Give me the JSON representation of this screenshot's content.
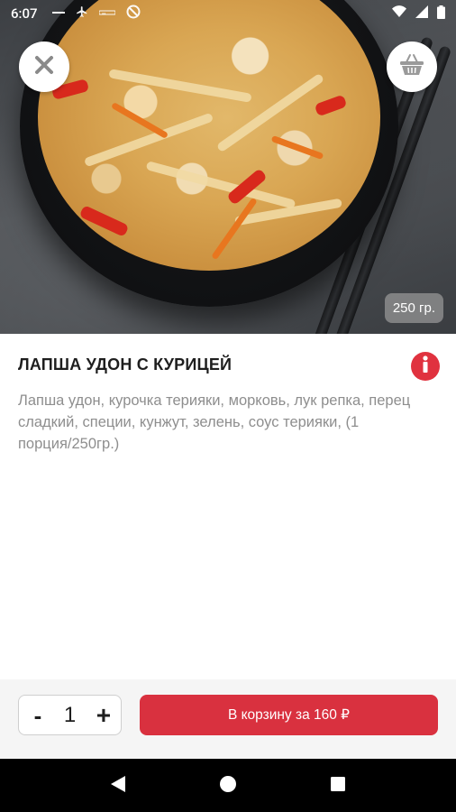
{
  "status_bar": {
    "time": "6:07",
    "icons_left": [
      "silent-icon",
      "airplane-icon",
      "data-icon",
      "mute-icon"
    ],
    "icons_right": [
      "wifi-icon",
      "signal-icon",
      "battery-icon"
    ]
  },
  "hero": {
    "weight_badge": "250 гр."
  },
  "product": {
    "title": "ЛАПША УДОН С КУРИЦЕЙ",
    "description": "Лапша удон, курочка терияки, морковь, лук репка, перец сладкий, специи, кунжут, зелень, соус терияки, (1 порция/250гр.)"
  },
  "cart": {
    "minus_label": "-",
    "quantity": "1",
    "plus_label": "+",
    "add_label": "В корзину за 160 ₽"
  },
  "colors": {
    "accent": "#d9313f",
    "info": "#e0323f",
    "title": "#1e1e1e",
    "description": "#8e8e8e"
  }
}
